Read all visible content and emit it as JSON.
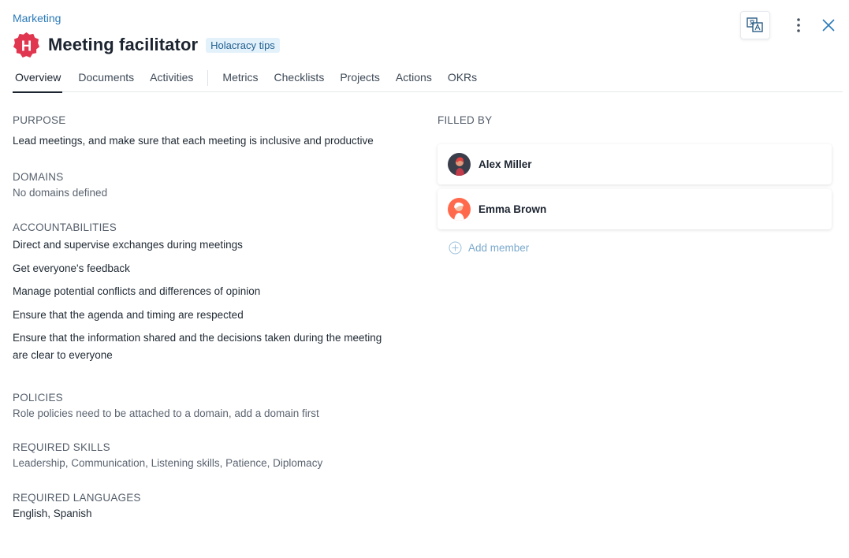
{
  "breadcrumb": "Marketing",
  "header": {
    "logo_letter": "H",
    "title": "Meeting facilitator",
    "tag": "Holacracy tips"
  },
  "tabs": [
    "Overview",
    "Documents",
    "Activities",
    "Metrics",
    "Checklists",
    "Projects",
    "Actions",
    "OKRs"
  ],
  "purpose": {
    "label": "PURPOSE",
    "text": "Lead meetings, and make sure that each meeting is inclusive and productive"
  },
  "domains": {
    "label": "DOMAINS",
    "text": "No domains defined"
  },
  "accountabilities": {
    "label": "ACCOUNTABILITIES",
    "items": [
      "Direct and supervise exchanges during meetings",
      "Get everyone's feedback",
      "Manage potential conflicts and differences of opinion",
      "Ensure that the agenda and timing are respected",
      "Ensure that the information shared and the decisions taken during the meeting are clear to everyone"
    ]
  },
  "policies": {
    "label": "POLICIES",
    "text": "Role policies need to be attached to a domain, add a domain first"
  },
  "skills": {
    "label": "REQUIRED SKILLS",
    "text": "Leadership, Communication, Listening skills, Patience, Diplomacy"
  },
  "languages": {
    "label": "REQUIRED LANGUAGES",
    "text": "English, Spanish"
  },
  "filled_by": {
    "label": "FILLED BY",
    "members": [
      "Alex Miller",
      "Emma Brown"
    ],
    "add_label": "Add member"
  },
  "colors": {
    "brand": "#e0364f",
    "link": "#2a7ab8",
    "tag_bg": "#e3f1fb"
  },
  "icons": {
    "translate": "translate-icon",
    "more": "more-vertical-icon",
    "close": "close-icon",
    "add": "plus-circle-icon"
  }
}
